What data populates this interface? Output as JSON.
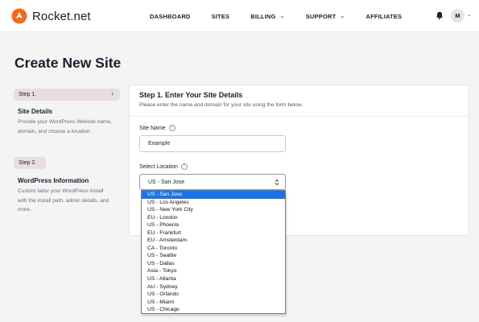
{
  "brand": {
    "name": "Rocket.net"
  },
  "nav": {
    "items": [
      {
        "label": "DASHBOARD",
        "has_menu": false
      },
      {
        "label": "SITES",
        "has_menu": false
      },
      {
        "label": "BILLING",
        "has_menu": true
      },
      {
        "label": "SUPPORT",
        "has_menu": true
      },
      {
        "label": "AFFILIATES",
        "has_menu": false
      }
    ],
    "avatar_initial": "M"
  },
  "page": {
    "title": "Create New Site"
  },
  "steps": [
    {
      "pill": "Step 1.",
      "title": "Site Details",
      "description": "Provide your WordPress Website name, domain, and choose a location."
    },
    {
      "pill": "Step 2.",
      "title": "WordPress Information",
      "description": "Custom tailor your WordPress install with the install path, admin details, and more."
    }
  ],
  "form": {
    "heading": "Step 1. Enter Your Site Details",
    "subheading": "Please enter the name and domain for your site using the form below.",
    "site_name": {
      "label": "Site Name",
      "value": "Example"
    },
    "location": {
      "label": "Select Location",
      "value": "US - San Jose",
      "options": [
        "US - San Jose",
        "US - Los Angeles",
        "US - New York City",
        "EU - London",
        "US - Phoenix",
        "EU - Frankfurt",
        "EU - Amsterdam",
        "CA - Toronto",
        "US - Seattle",
        "US - Dallas",
        "Asia - Tokyo",
        "US - Atlanta",
        "AU - Sydney",
        "US - Orlando",
        "US - Miami",
        "US - Chicago"
      ],
      "selected_index": 0
    }
  },
  "colors": {
    "brand_orange": "#f26b1d",
    "step_pill_bg": "#e8dde0",
    "dropdown_highlight": "#1a73e8"
  }
}
